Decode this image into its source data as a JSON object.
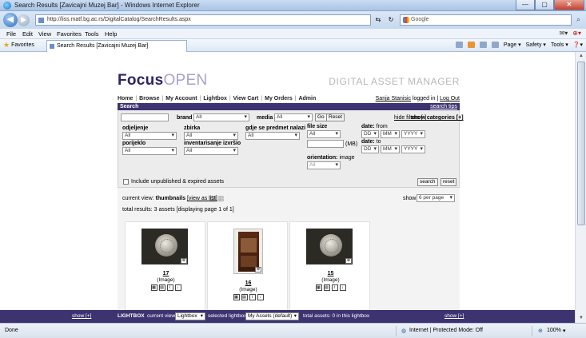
{
  "window": {
    "title": "Search Results [Zavicajni Muzej Bar] - Windows Internet Explorer",
    "url": "http://liss.matf.bg.ac.rs/DigitalCatalog/SearchResults.aspx",
    "search_placeholder": "Google",
    "minimize": "—",
    "maximize": "▢",
    "close": "✕"
  },
  "menu": [
    "File",
    "Edit",
    "View",
    "Favorites",
    "Tools",
    "Help"
  ],
  "favbar": {
    "favorites": "Favorites",
    "tab_title": "Search Results [Zavicajni Muzej Bar]",
    "commands": [
      "Page ▾",
      "Safety ▾",
      "Tools ▾",
      "❓▾"
    ]
  },
  "site": {
    "logo_a": "Focus",
    "logo_b": "OPEN",
    "tagline": "DIGITAL ASSET MANAGER",
    "nav": [
      "Home",
      "Browse",
      "My Account",
      "Lightbox",
      "View Cart",
      "My Orders",
      "Admin"
    ],
    "user_name": "Sanja Stanisic",
    "logged_in": " logged in",
    "logout": "Log Out"
  },
  "search": {
    "bar_title": "Search",
    "tips": "search tips",
    "brand_label": "brand",
    "brand_value": "All",
    "media_label": "media",
    "media_value": "All",
    "go": "Go",
    "reset": "Reset",
    "hide_filters": "hide filters [-]",
    "show_categories": "show categories [+]",
    "filters": [
      {
        "label": "odjeljenje",
        "value": "All"
      },
      {
        "label": "zbirka",
        "value": "All"
      },
      {
        "label": "gdje se predmet nalazi",
        "value": "All"
      },
      {
        "label": "porijeklo",
        "value": "All"
      },
      {
        "label": "inventarisanje izvršio",
        "value": "All"
      }
    ],
    "file_size_label": "file size",
    "file_size_value": "All",
    "mb": "(MB)",
    "orientation_label": "orientation:",
    "orientation_sub": "image",
    "orientation_value": "All",
    "date_from_label": "date:",
    "date_from_sub": "from",
    "date_to_label": "date:",
    "date_to_sub": "to",
    "dd": "DD",
    "mm": "MM",
    "yyyy": "YYYY",
    "include_unpublished": "Include unpublished & expired assets",
    "search_btn": "search",
    "reset_btn": "reset"
  },
  "results": {
    "current_view_label": "current view:",
    "current_view": "thumbnails",
    "view_as_list": "[view as list]",
    "show_label": "show",
    "per_page": "6 per page",
    "total": "total results: 3 assets [displaying page 1 of 1]",
    "items": [
      {
        "id": "17",
        "type": "(Image)"
      },
      {
        "id": "16",
        "type": "(Image)"
      },
      {
        "id": "15",
        "type": "(Image)"
      }
    ]
  },
  "lightbox": {
    "show_left": "show [+]",
    "title": "LIGHTBOX",
    "current_view_label": "current view",
    "current_view": "Lightbox",
    "selected_label": "selected lightbox",
    "selected": "My Assets (default)",
    "total": "total assets: 0 in this lightbox",
    "show_right": "show [+]"
  },
  "status": {
    "done": "Done",
    "zone": "Internet | Protected Mode: Off",
    "zoom": "100%"
  }
}
